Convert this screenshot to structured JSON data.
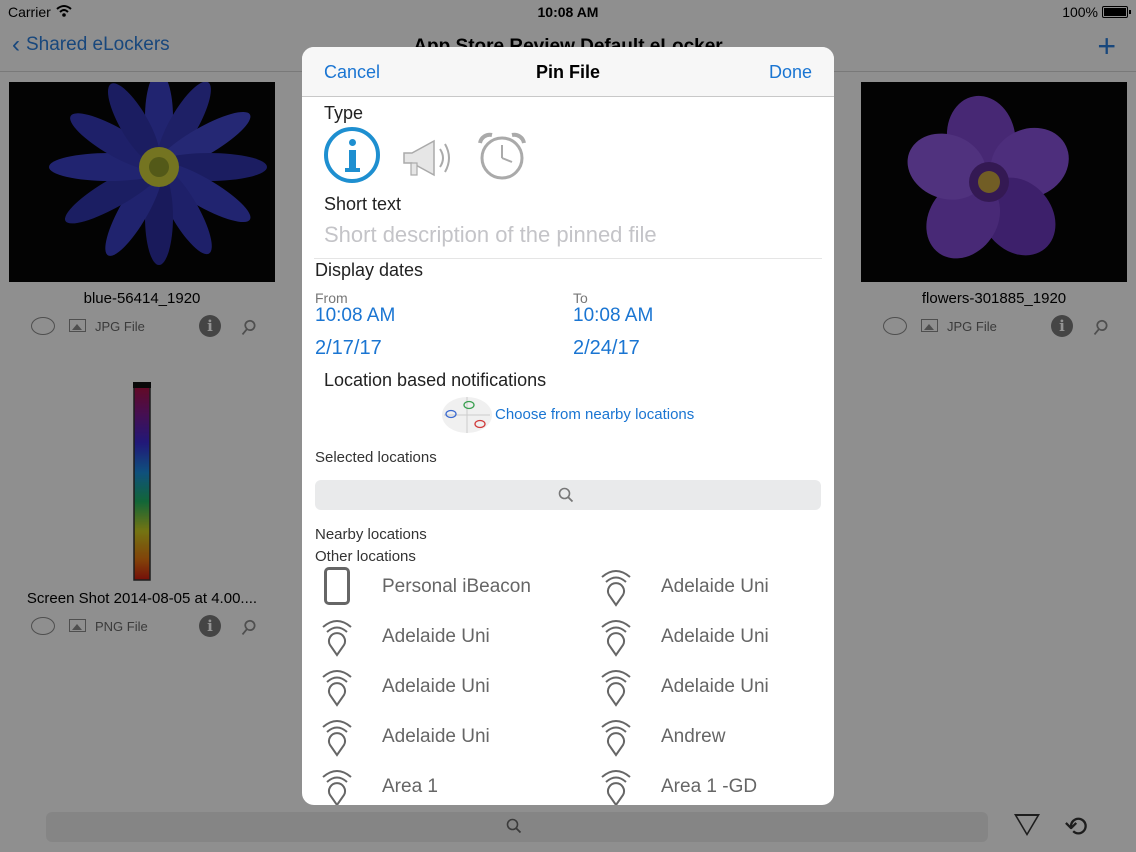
{
  "status_bar": {
    "carrier": "Carrier",
    "time": "10:08 AM",
    "battery": "100%"
  },
  "nav_bar": {
    "back_label": "Shared eLockers",
    "title": "App Store Review Default eLocker"
  },
  "files": [
    {
      "name": "blue-56414_1920",
      "type": "JPG File"
    },
    {
      "name": "flowers-301885_1920",
      "type": "JPG File"
    },
    {
      "name": "Screen Shot 2014-08-05 at 4.00....",
      "type": "PNG File"
    }
  ],
  "modal": {
    "cancel": "Cancel",
    "title": "Pin File",
    "done": "Done",
    "type_label": "Type",
    "short_text_label": "Short text",
    "short_text_placeholder": "Short description of the pinned file",
    "display_dates_label": "Display dates",
    "from_label": "From",
    "from_time": "10:08 AM",
    "from_date": "2/17/17",
    "to_label": "To",
    "to_time": "10:08 AM",
    "to_date": "2/24/17",
    "location_label": "Location based notifications",
    "choose_nearby": "Choose from nearby locations",
    "selected_locations": "Selected locations",
    "nearby_locations": "Nearby locations",
    "other_locations": "Other locations",
    "locations_left": [
      "Personal iBeacon",
      "Adelaide Uni",
      "Adelaide Uni",
      "Adelaide Uni",
      "Area 1"
    ],
    "locations_right": [
      "Adelaide Uni",
      "Adelaide Uni",
      "Adelaide Uni",
      "Andrew",
      "Area 1 -GD"
    ]
  },
  "colors": {
    "accent": "#1a75d2",
    "info_icon": "#1e8fd0"
  }
}
